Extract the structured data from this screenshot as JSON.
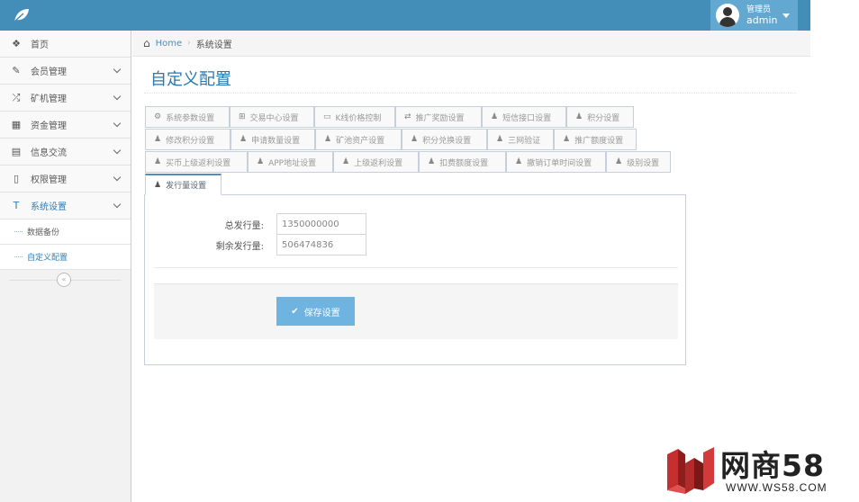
{
  "header": {
    "user_role": "管理员",
    "user_name": "admin"
  },
  "sidebar": {
    "items": [
      {
        "label": "首页",
        "icon": "dashboard-icon",
        "glyph": "❖"
      },
      {
        "label": "会员管理",
        "icon": "edit-icon",
        "glyph": "✎"
      },
      {
        "label": "矿机管理",
        "icon": "random-icon",
        "glyph": "⤮"
      },
      {
        "label": "资金管理",
        "icon": "calendar-icon",
        "glyph": "▦"
      },
      {
        "label": "信息交流",
        "icon": "list-alt-icon",
        "glyph": "▤"
      },
      {
        "label": "权限管理",
        "icon": "file-icon",
        "glyph": "▯"
      },
      {
        "label": "系统设置",
        "icon": "text-icon",
        "glyph": "T"
      }
    ],
    "sub_items": [
      {
        "label": "数据备份"
      },
      {
        "label": "自定义配置"
      }
    ],
    "collapse_glyph": "«"
  },
  "breadcrumb": {
    "home": "Home",
    "current": "系统设置"
  },
  "page": {
    "title": "自定义配置"
  },
  "tabs": [
    {
      "label": "系统参数设置",
      "icon": "cogs-icon",
      "glyph": "⚙"
    },
    {
      "label": "交易中心设置",
      "icon": "plus-square-icon",
      "glyph": "⊞"
    },
    {
      "label": "K线价格控制",
      "icon": "credit-card-icon",
      "glyph": "▭"
    },
    {
      "label": "推广奖励设置",
      "icon": "exchange-icon",
      "glyph": "⇄"
    },
    {
      "label": "短信接口设置",
      "icon": "user-icon",
      "glyph": "♟"
    },
    {
      "label": "积分设置",
      "icon": "user-icon",
      "glyph": "♟"
    },
    {
      "label": "修改积分设置",
      "icon": "user-icon",
      "glyph": "♟"
    },
    {
      "label": "申请数量设置",
      "icon": "user-icon",
      "glyph": "♟"
    },
    {
      "label": "矿池资产设置",
      "icon": "user-icon",
      "glyph": "♟"
    },
    {
      "label": "积分兑换设置",
      "icon": "user-icon",
      "glyph": "♟"
    },
    {
      "label": "三网验证",
      "icon": "user-icon",
      "glyph": "♟"
    },
    {
      "label": "推广额度设置",
      "icon": "user-icon",
      "glyph": "♟"
    },
    {
      "label": "买币上级返利设置",
      "icon": "user-icon",
      "glyph": "♟"
    },
    {
      "label": "APP地址设置",
      "icon": "user-icon",
      "glyph": "♟"
    },
    {
      "label": "上级返利设置",
      "icon": "user-icon",
      "glyph": "♟"
    },
    {
      "label": "扣费额度设置",
      "icon": "user-icon",
      "glyph": "♟"
    },
    {
      "label": "撤销订单时间设置",
      "icon": "user-icon",
      "glyph": "♟"
    },
    {
      "label": "级别设置",
      "icon": "user-icon",
      "glyph": "♟"
    },
    {
      "label": "发行量设置",
      "icon": "user-icon",
      "glyph": "♟"
    }
  ],
  "form": {
    "total_label": "总发行量:",
    "total_value": "1350000000",
    "remaining_label": "剩余发行量:",
    "remaining_value": "506474836",
    "save_label": "保存设置"
  },
  "watermark": {
    "brand": "网商58",
    "url": "WWW.WS58.COM"
  },
  "colors": {
    "navbar": "#438eb9",
    "user_box": "#62a8d1",
    "title": "#2679b5",
    "save_button": "#6fb3e0"
  }
}
